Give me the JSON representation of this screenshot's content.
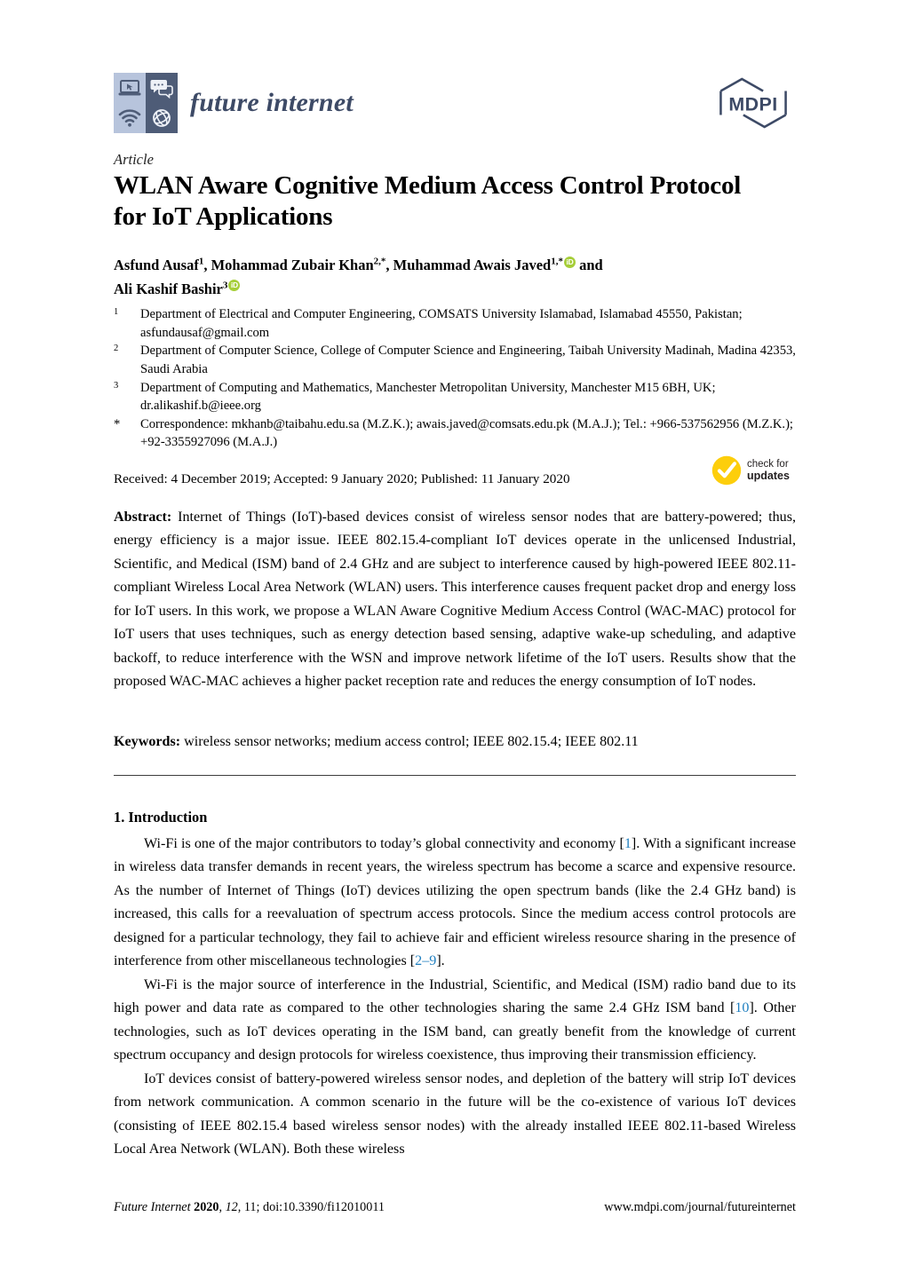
{
  "header": {
    "journal_name": "future internet",
    "publisher_logo": "MDPI",
    "logo_icons": [
      "laptop-icon",
      "chat-icon",
      "wifi-icon",
      "globe-icon"
    ]
  },
  "article": {
    "type_label": "Article",
    "title": "WLAN Aware Cognitive Medium Access Control Protocol for IoT Applications"
  },
  "authors": {
    "line1_parts": [
      {
        "name": "Asfund Ausaf",
        "sup": "1",
        "sep": ", "
      },
      {
        "name": "Mohammad Zubair Khan",
        "sup": "2,*",
        "sep": ", "
      },
      {
        "name": "Muhammad Awais Javed",
        "sup": "1,*",
        "orcid": true,
        "sep": " and"
      }
    ],
    "line2_parts": [
      {
        "name": "Ali Kashif Bashir",
        "sup": "3",
        "orcid": true,
        "sep": ""
      }
    ],
    "orcid_label": "iD"
  },
  "affiliations": [
    {
      "mark": "1",
      "text": "Department of Electrical and Computer Engineering, COMSATS University Islamabad, Islamabad 45550, Pakistan; asfundausaf@gmail.com"
    },
    {
      "mark": "2",
      "text": "Department of Computer Science, College of Computer Science and Engineering, Taibah University Madinah, Madina 42353, Saudi Arabia"
    },
    {
      "mark": "3",
      "text": "Department of Computing and Mathematics, Manchester Metropolitan University, Manchester M15 6BH, UK; dr.alikashif.b@ieee.org"
    },
    {
      "mark": "*",
      "text": "Correspondence: mkhanb@taibahu.edu.sa (M.Z.K.); awais.javed@comsats.edu.pk (M.A.J.); Tel.: +966-537562956 (M.Z.K.); +92-3355927096 (M.A.J.)"
    }
  ],
  "dates": "Received: 4 December 2019; Accepted: 9 January 2020; Published: 11 January 2020",
  "updates_badge": {
    "line1": "check for",
    "line2": "updates",
    "color": "#FDCE0B"
  },
  "abstract": {
    "label": "Abstract:",
    "text": "Internet of Things (IoT)-based devices consist of wireless sensor nodes that are battery-powered; thus, energy efficiency is a major issue. IEEE 802.15.4-compliant IoT devices operate in the unlicensed Industrial, Scientific, and Medical (ISM) band of 2.4 GHz and are subject to interference caused by high-powered IEEE 802.11-compliant Wireless Local Area Network (WLAN) users. This interference causes frequent packet drop and energy loss for IoT users. In this work, we propose a WLAN Aware Cognitive Medium Access Control (WAC-MAC) protocol for IoT users that uses techniques, such as energy detection based sensing, adaptive wake-up scheduling, and adaptive backoff, to reduce interference with the WSN and improve network lifetime of the IoT users. Results show that the proposed WAC-MAC achieves a higher packet reception rate and reduces the energy consumption of IoT nodes."
  },
  "keywords": {
    "label": "Keywords:",
    "text": "wireless sensor networks; medium access control; IEEE 802.15.4; IEEE 802.11"
  },
  "section": {
    "heading": "1. Introduction",
    "paragraphs": [
      {
        "segments": [
          {
            "t": "Wi-Fi is one of the major contributors to today’s global connectivity and economy ["
          },
          {
            "t": "1",
            "cite": true
          },
          {
            "t": "]. With a significant increase in wireless data transfer demands in recent years, the wireless spectrum has become a scarce and expensive resource. As the number of Internet of Things (IoT) devices utilizing the open spectrum bands (like the 2.4 GHz band) is increased, this calls for a reevaluation of spectrum access protocols. Since the medium access control protocols are designed for a particular technology, they fail to achieve fair and efficient wireless resource sharing in the presence of interference from other miscellaneous technologies ["
          },
          {
            "t": "2–9",
            "cite": true
          },
          {
            "t": "]."
          }
        ]
      },
      {
        "segments": [
          {
            "t": "Wi-Fi is the major source of interference in the Industrial, Scientific, and Medical (ISM) radio band due to its high power and data rate as compared to the other technologies sharing the same 2.4 GHz ISM band ["
          },
          {
            "t": "10",
            "cite": true
          },
          {
            "t": "]. Other technologies, such as IoT devices operating in the ISM band, can greatly benefit from the knowledge of current spectrum occupancy and design protocols for wireless coexistence, thus improving their transmission efficiency."
          }
        ]
      },
      {
        "segments": [
          {
            "t": "IoT devices consist of battery-powered wireless sensor nodes, and depletion of the battery will strip IoT devices from network communication. A common scenario in the future will be the co-existence of various IoT devices (consisting of IEEE 802.15.4 based wireless sensor nodes) with the already installed IEEE 802.11-based Wireless Local Area Network (WLAN). Both these wireless"
          }
        ]
      }
    ]
  },
  "footer": {
    "journal": "Future Internet",
    "year": "2020",
    "volume": "12",
    "article_no": "11",
    "doi": "doi:10.3390/fi12010011",
    "url": "www.mdpi.com/journal/futureinternet"
  }
}
